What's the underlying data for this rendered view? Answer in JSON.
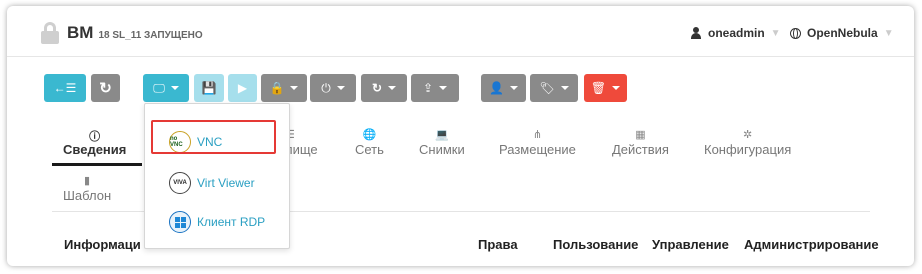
{
  "header": {
    "vm_label": "ВМ",
    "vm_sub": "18 SL_11 ЗАПУЩЕНО",
    "user": "oneadmin",
    "zone": "OpenNebula"
  },
  "toolbar": {
    "back_label": "←☰",
    "refresh_label": "↻",
    "console_label": "🖵",
    "save_label": "💾",
    "play_label": "▶",
    "lock_label": "🔒",
    "power_label": "⏻",
    "reboot_label": "↻",
    "share_label": "⇪",
    "user_label": "👤",
    "tag_label": "🏷",
    "delete_label": "🗑"
  },
  "tabs": [
    {
      "label": "Сведения",
      "icon": "info-icon",
      "glyph": "ⓘ"
    },
    {
      "label": "лище",
      "icon": "storage-icon",
      "glyph": "☰"
    },
    {
      "label": "Сеть",
      "icon": "globe-icon",
      "glyph": "🌐"
    },
    {
      "label": "Снимки",
      "icon": "laptop-icon",
      "glyph": "💻"
    },
    {
      "label": "Размещение",
      "icon": "sitemap-icon",
      "glyph": "⋔"
    },
    {
      "label": "Действия",
      "icon": "calendar-icon",
      "glyph": "▦"
    },
    {
      "label": "Конфигурация",
      "icon": "cog-icon",
      "glyph": "✲"
    },
    {
      "label": "Шаблон",
      "icon": "file-icon",
      "glyph": "▮"
    }
  ],
  "table_headers": [
    "Информаци",
    "Права",
    "Пользование",
    "Управление",
    "Администрирование"
  ],
  "dropdown": {
    "items": [
      {
        "label": "VNC",
        "icon": "novnc-icon",
        "icon_text": "no VNC"
      },
      {
        "label": "Virt Viewer",
        "icon": "virt-viewer-icon",
        "icon_text": "VIVA"
      },
      {
        "label": "Клиент RDP",
        "icon": "windows-icon",
        "icon_text": ""
      }
    ]
  },
  "colors": {
    "teal": "#3ab8d0",
    "grey": "#8a8a8a",
    "red": "#ef4a3b",
    "link": "#2a9fc2",
    "highlight": "#e53935"
  }
}
